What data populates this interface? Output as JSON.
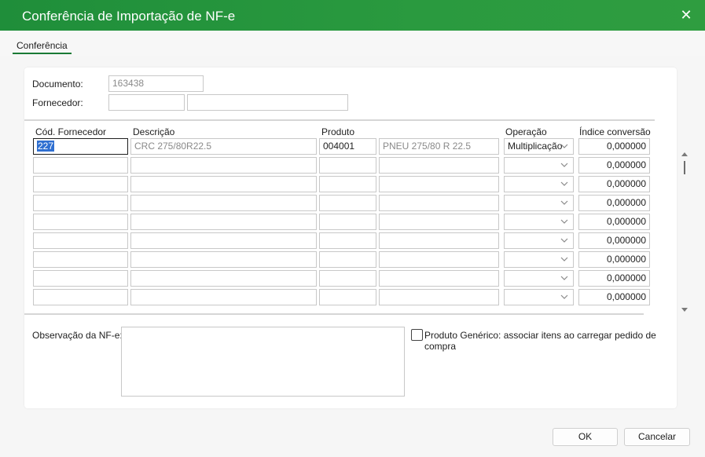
{
  "window": {
    "title": "Conferência de Importação de NF-e"
  },
  "tabs": [
    {
      "label": "Conferência"
    }
  ],
  "form": {
    "documento_label": "Documento:",
    "documento_value": "163438",
    "fornecedor_label": "Fornecedor:",
    "fornecedor_code": "",
    "fornecedor_name": ""
  },
  "grid": {
    "headers": {
      "cod": "Cód. Fornecedor",
      "descricao": "Descrição",
      "produto": "Produto",
      "operacao": "Operação",
      "indice": "Índice conversão"
    },
    "rows": [
      {
        "cod": "227",
        "descricao": "CRC 275/80R22.5",
        "produto": "004001",
        "produto_desc": "PNEU 275/80 R 22.5",
        "operacao": "Multiplicação",
        "indice": "0,000000"
      },
      {
        "cod": "",
        "descricao": "",
        "produto": "",
        "produto_desc": "",
        "operacao": "",
        "indice": "0,000000"
      },
      {
        "cod": "",
        "descricao": "",
        "produto": "",
        "produto_desc": "",
        "operacao": "",
        "indice": "0,000000"
      },
      {
        "cod": "",
        "descricao": "",
        "produto": "",
        "produto_desc": "",
        "operacao": "",
        "indice": "0,000000"
      },
      {
        "cod": "",
        "descricao": "",
        "produto": "",
        "produto_desc": "",
        "operacao": "",
        "indice": "0,000000"
      },
      {
        "cod": "",
        "descricao": "",
        "produto": "",
        "produto_desc": "",
        "operacao": "",
        "indice": "0,000000"
      },
      {
        "cod": "",
        "descricao": "",
        "produto": "",
        "produto_desc": "",
        "operacao": "",
        "indice": "0,000000"
      },
      {
        "cod": "",
        "descricao": "",
        "produto": "",
        "produto_desc": "",
        "operacao": "",
        "indice": "0,000000"
      },
      {
        "cod": "",
        "descricao": "",
        "produto": "",
        "produto_desc": "",
        "operacao": "",
        "indice": "0,000000"
      }
    ]
  },
  "observacao": {
    "label": "Observação da NF-e:",
    "value": ""
  },
  "generic_product": {
    "label": "Produto Genérico: associar itens ao carregar pedido de compra",
    "checked": false
  },
  "buttons": {
    "ok": "OK",
    "cancel": "Cancelar"
  },
  "icons": {
    "close": "close-icon",
    "dropdown": "chevron-down-icon",
    "scroll_up": "arrow-up-icon",
    "scroll_down": "arrow-down-icon"
  },
  "colors": {
    "title_bar": "#2a9a3f",
    "tab_underline": "#1a7a35",
    "selection": "#2f6fd1"
  }
}
